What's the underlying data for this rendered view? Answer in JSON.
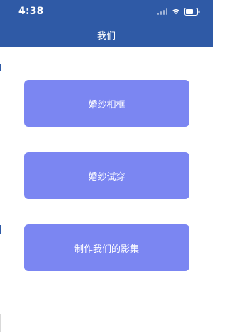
{
  "status_bar": {
    "time": "4:38"
  },
  "header": {
    "title": "我们"
  },
  "menu": {
    "items": [
      {
        "label": "婚纱相框"
      },
      {
        "label": "婚纱试穿"
      },
      {
        "label": "制作我们的影集"
      }
    ]
  },
  "colors": {
    "header_bg": "#2f5aa6",
    "button_bg": "#7b86f2",
    "text_on_dark": "#ffffff"
  }
}
